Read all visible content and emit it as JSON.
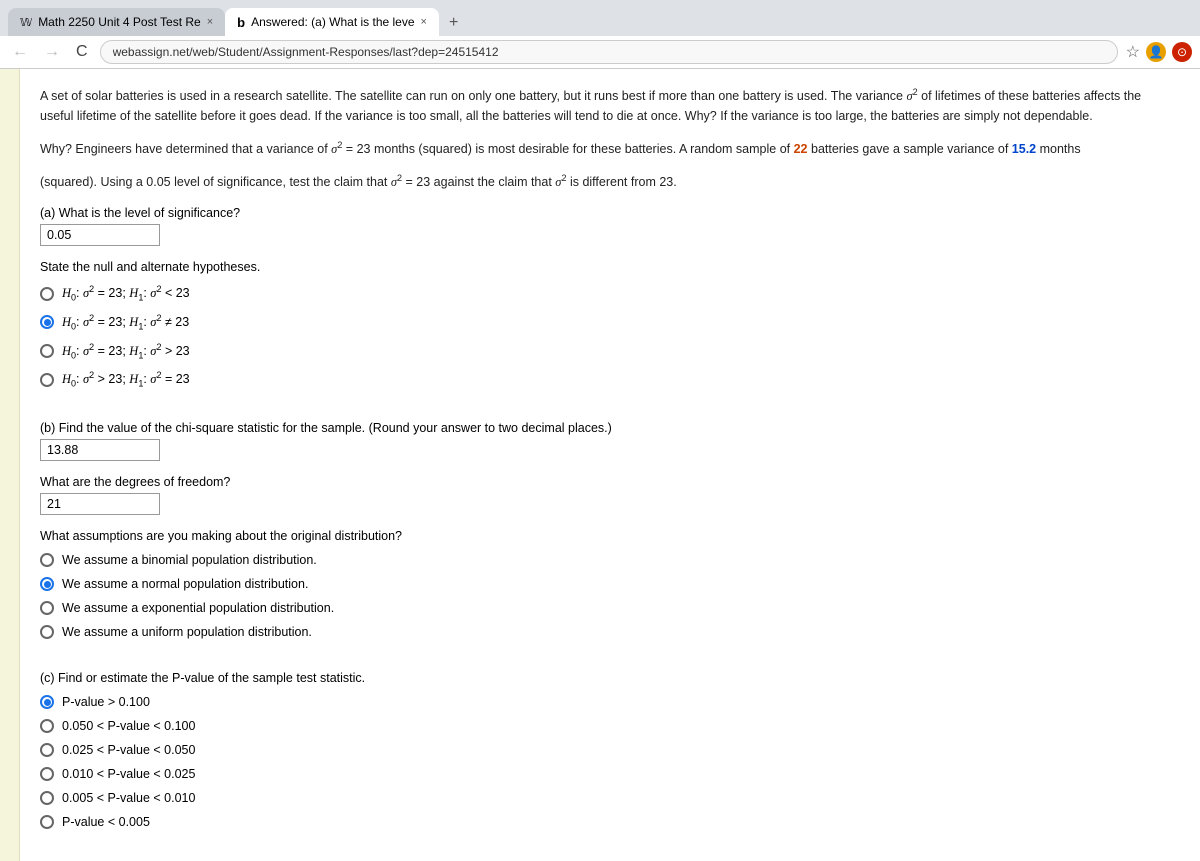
{
  "browser": {
    "tabs": [
      {
        "id": "tab1",
        "icon": "🅆",
        "title": "Math 2250 Unit 4 Post Test Re",
        "active": false,
        "close": "×"
      },
      {
        "id": "tab2",
        "icon": "b",
        "title": "Answered: (a) What is the leve",
        "active": true,
        "close": "×"
      }
    ],
    "new_tab": "+",
    "address": "webassign.net/web/Student/Assignment-Responses/last?dep=24515412",
    "back": "←",
    "forward": "→",
    "refresh": "C",
    "star": "☆",
    "profile": "👤"
  },
  "page": {
    "intro": {
      "paragraph1": "A set of solar batteries is used in a research satellite. The satellite can run on only one battery, but it runs best if more than one battery is used. The variance σ² of lifetimes of these batteries affects the useful lifetime of the satellite before it goes dead. If the variance is too small, all the batteries will tend to die at once. Why? If the variance is too large, the batteries are simply not dependable.",
      "paragraph2_prefix": "Why? Engineers have determined that a variance of σ² = 23 months (squared) is most desirable for these batteries. A random sample of ",
      "highlight1": "22",
      "paragraph2_mid": " batteries gave a sample variance of ",
      "highlight2": "15.2",
      "paragraph2_suffix": " months",
      "paragraph3": "(squared). Using a 0.05 level of significance, test the claim that σ² = 23 against the claim that σ² is different from 23."
    },
    "part_a": {
      "label": "(a) What is the level of significance?",
      "input_value": "0.05",
      "input_placeholder": ""
    },
    "state_hypotheses": {
      "label": "State the null and alternate hypotheses.",
      "options": [
        {
          "id": "h1",
          "text_html": "H₀: σ² = 23; H₁: σ² < 23",
          "selected": false
        },
        {
          "id": "h2",
          "text_html": "H₀: σ² = 23; H₁: σ² ≠ 23",
          "selected": true
        },
        {
          "id": "h3",
          "text_html": "H₀: σ² = 23; H₁: σ² > 23",
          "selected": false
        },
        {
          "id": "h4",
          "text_html": "H₀: σ² > 23; H₁: σ² = 23",
          "selected": false
        }
      ]
    },
    "part_b": {
      "chi_square_label": "(b) Find the value of the chi-square statistic for the sample. (Round your answer to two decimal places.)",
      "chi_square_value": "13.88",
      "df_label": "What are the degrees of freedom?",
      "df_value": "21"
    },
    "assumptions": {
      "label": "What assumptions are you making about the original distribution?",
      "options": [
        {
          "id": "a1",
          "text": "We assume a binomial population distribution.",
          "selected": false
        },
        {
          "id": "a2",
          "text": "We assume a normal population distribution.",
          "selected": true
        },
        {
          "id": "a3",
          "text": "We assume a exponential population distribution.",
          "selected": false
        },
        {
          "id": "a4",
          "text": "We assume a uniform population distribution.",
          "selected": false
        }
      ]
    },
    "part_c": {
      "label": "(c) Find or estimate the P-value of the sample test statistic.",
      "options": [
        {
          "id": "p1",
          "text": "P-value > 0.100",
          "selected": true
        },
        {
          "id": "p2",
          "text": "0.050 < P-value < 0.100",
          "selected": false
        },
        {
          "id": "p3",
          "text": "0.025 < P-value < 0.050",
          "selected": false
        },
        {
          "id": "p4",
          "text": "0.010 < P-value < 0.025",
          "selected": false
        },
        {
          "id": "p5",
          "text": "0.005 < P-value < 0.010",
          "selected": false
        },
        {
          "id": "p6",
          "text": "P-value < 0.005",
          "selected": false
        }
      ]
    }
  }
}
